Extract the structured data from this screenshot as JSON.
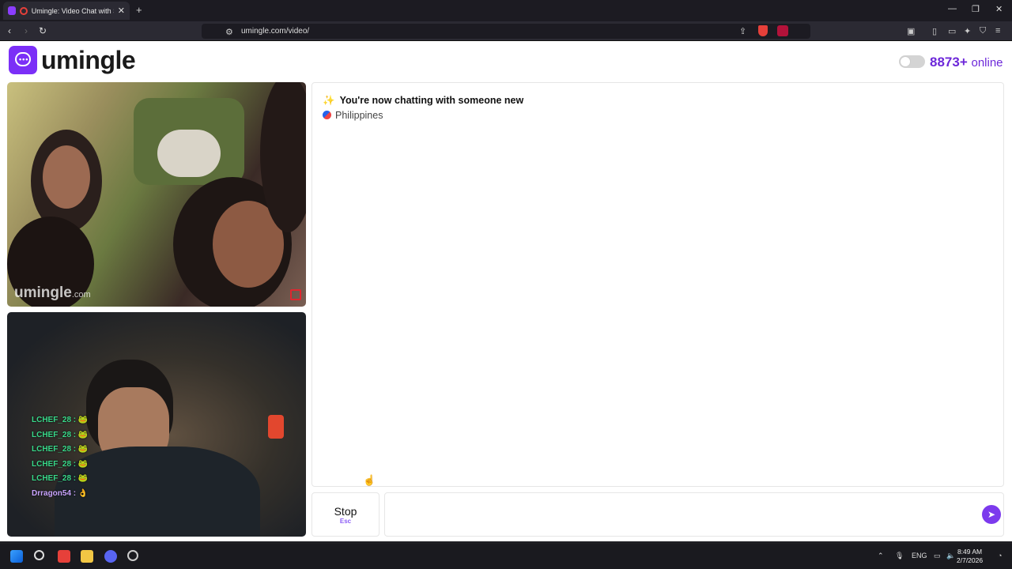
{
  "browser": {
    "tab_title": "Umingle: Video Chat with Stra",
    "url": "umingle.com/video/",
    "new_tab": "+",
    "close_tab": "✕"
  },
  "site": {
    "logo_text": "umingle",
    "online_count": "8873+",
    "online_label": "online"
  },
  "remote_video": {
    "watermark_main": "umingle",
    "watermark_suffix": ".com"
  },
  "local_video": {
    "chat_overlay": [
      {
        "user": "LCHEF_28 :",
        "emoji": "🐸"
      },
      {
        "user": "LCHEF_28 :",
        "emoji": "🐸"
      },
      {
        "user": "LCHEF_28 :",
        "emoji": "🐸"
      },
      {
        "user": "LCHEF_28 :",
        "emoji": "🐸"
      },
      {
        "user": "LCHEF_28 :",
        "emoji": "🐸"
      },
      {
        "user": "Drragon54 :",
        "emoji": "👌"
      }
    ]
  },
  "chat": {
    "status_message": "You're now chatting with someone new",
    "country": "Philippines"
  },
  "controls": {
    "stop_label": "Stop",
    "stop_key": "Esc",
    "message_placeholder": ""
  },
  "taskbar": {
    "lang": "ENG",
    "time": "8:49 AM",
    "date": "2/7/2026"
  }
}
